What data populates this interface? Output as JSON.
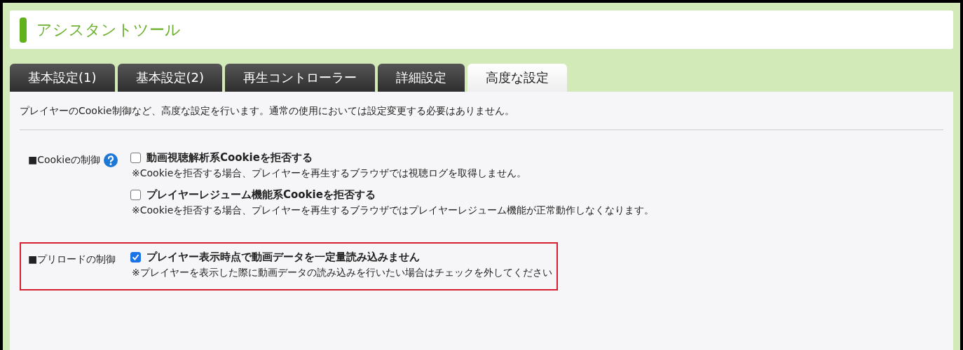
{
  "header": {
    "title": "アシスタントツール"
  },
  "tabs": [
    {
      "label": "基本設定(1)",
      "selected": false
    },
    {
      "label": "基本設定(2)",
      "selected": false
    },
    {
      "label": "再生コントローラー",
      "selected": false
    },
    {
      "label": "詳細設定",
      "selected": false
    },
    {
      "label": "高度な設定",
      "selected": true
    }
  ],
  "description": "プレイヤーのCookie制御など、高度な設定を行います。通常の使用においては設定変更する必要はありません。",
  "groups": [
    {
      "label": "■Cookieの制御",
      "help": true,
      "highlighted": false,
      "options": [
        {
          "label": "動画視聴解析系Cookieを拒否する",
          "checked": false,
          "note": "※Cookieを拒否する場合、プレイヤーを再生するブラウザでは視聴ログを取得しません。"
        },
        {
          "label": "プレイヤーレジューム機能系Cookieを拒否する",
          "checked": false,
          "note": "※Cookieを拒否する場合、プレイヤーを再生するブラウザではプレイヤーレジューム機能が正常動作しなくなります。"
        }
      ]
    },
    {
      "label": "■プリロードの制御",
      "help": false,
      "highlighted": true,
      "options": [
        {
          "label": "プレイヤー表示時点で動画データを一定量読み込みません",
          "checked": true,
          "note": "※プレイヤーを表示した際に動画データの読み込みを行いたい場合はチェックを外してください"
        }
      ]
    }
  ]
}
